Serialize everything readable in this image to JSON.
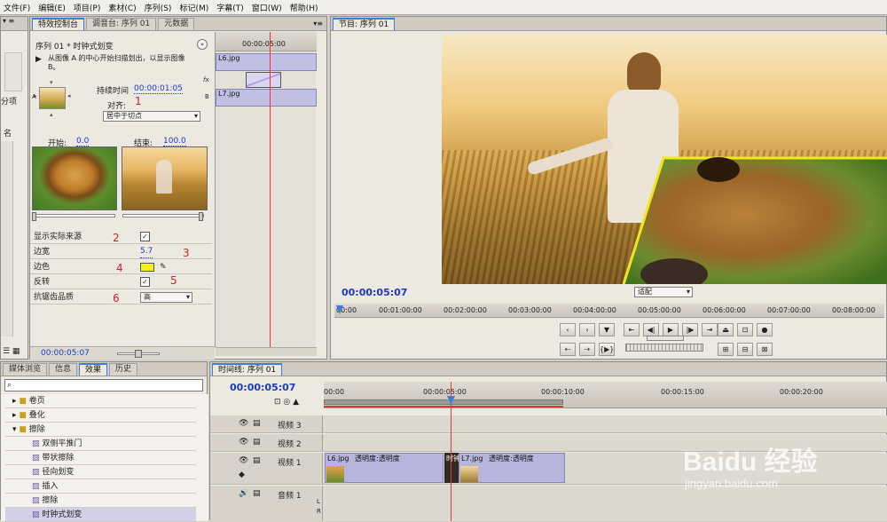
{
  "menu": [
    "文件(F)",
    "编辑(E)",
    "项目(P)",
    "素材(C)",
    "序列(S)",
    "标记(M)",
    "字幕(T)",
    "窗口(W)",
    "帮助(H)"
  ],
  "effect_controls": {
    "tabs": [
      "特效控制台",
      "调音台: 序列 01",
      "元数据"
    ],
    "header": "序列 01 * 时钟式划变",
    "description": "从图像 A 的中心开始扫描划出，以显示图像 B。",
    "duration_label": "持续时间",
    "duration_value": "00:00:01:05",
    "align_label": "对齐:",
    "align_value": "居中于切点",
    "start_label": "开始:",
    "start_value": "0.0",
    "end_label": "结束:",
    "end_value": "100.0",
    "label_a": "A",
    "label_b": "B",
    "props": [
      {
        "label": "显示实际来源",
        "kind": "checkbox",
        "value": "✓"
      },
      {
        "label": "边宽",
        "kind": "value",
        "value": "5.7"
      },
      {
        "label": "边色",
        "kind": "color",
        "value": "#f2f21a"
      },
      {
        "label": "反转",
        "kind": "checkbox",
        "value": "✓"
      },
      {
        "label": "抗锯齿品质",
        "kind": "dropdown",
        "value": "高"
      }
    ],
    "annotations": [
      "1",
      "2",
      "3",
      "4",
      "5",
      "6"
    ],
    "timecode": "00:00:05:07"
  },
  "mini_timeline": {
    "time": "00:00:05:00",
    "clip_a": "L6.jpg",
    "clip_b": "L7.jpg"
  },
  "left_stub": {
    "label1": "分项",
    "label2": "名"
  },
  "program_monitor": {
    "tab": "节目: 序列 01",
    "timecode": "00:00:05:07",
    "fit_value": "适配",
    "ruler": [
      "00:00",
      "00:01:00:00",
      "00:02:00:00",
      "00:03:00:00",
      "00:04:00:00",
      "00:05:00:00",
      "00:06:00:00",
      "00:07:00:00",
      "00:08:00:00"
    ],
    "border_color": "#f0e81e"
  },
  "effects_panel": {
    "tabs": [
      "媒体浏览",
      "信息",
      "效果",
      "历史"
    ],
    "search_placeholder": "",
    "items": [
      {
        "label": "卷页",
        "type": "folder"
      },
      {
        "label": "叠化",
        "type": "folder"
      },
      {
        "label": "擦除",
        "type": "folder-open"
      },
      {
        "label": "双侧平推门",
        "type": "effect"
      },
      {
        "label": "带状擦除",
        "type": "effect"
      },
      {
        "label": "径向划变",
        "type": "effect"
      },
      {
        "label": "插入",
        "type": "effect"
      },
      {
        "label": "擦除",
        "type": "effect"
      },
      {
        "label": "时钟式划变",
        "type": "effect"
      }
    ]
  },
  "timeline": {
    "tab": "时间线: 序列 01",
    "timecode": "00:00:05:07",
    "ruler": [
      "00:00",
      "00:00:05:00",
      "00:00:10:00",
      "00:00:15:00",
      "00:00:20:00"
    ],
    "tracks": [
      {
        "name": "视频 3"
      },
      {
        "name": "视频 2"
      },
      {
        "name": "视频 1"
      },
      {
        "name": "音频 1"
      }
    ],
    "clip1": {
      "name": "L6.jpg",
      "opacity": "透明度:透明度"
    },
    "transition": "时钟式",
    "clip2": {
      "name": "L7.jpg",
      "opacity": "透明度:透明度"
    },
    "audio_lr": [
      "L",
      "R"
    ]
  },
  "watermark": {
    "brand": "Baidu 经验",
    "url": "jingyan.baidu.com"
  }
}
